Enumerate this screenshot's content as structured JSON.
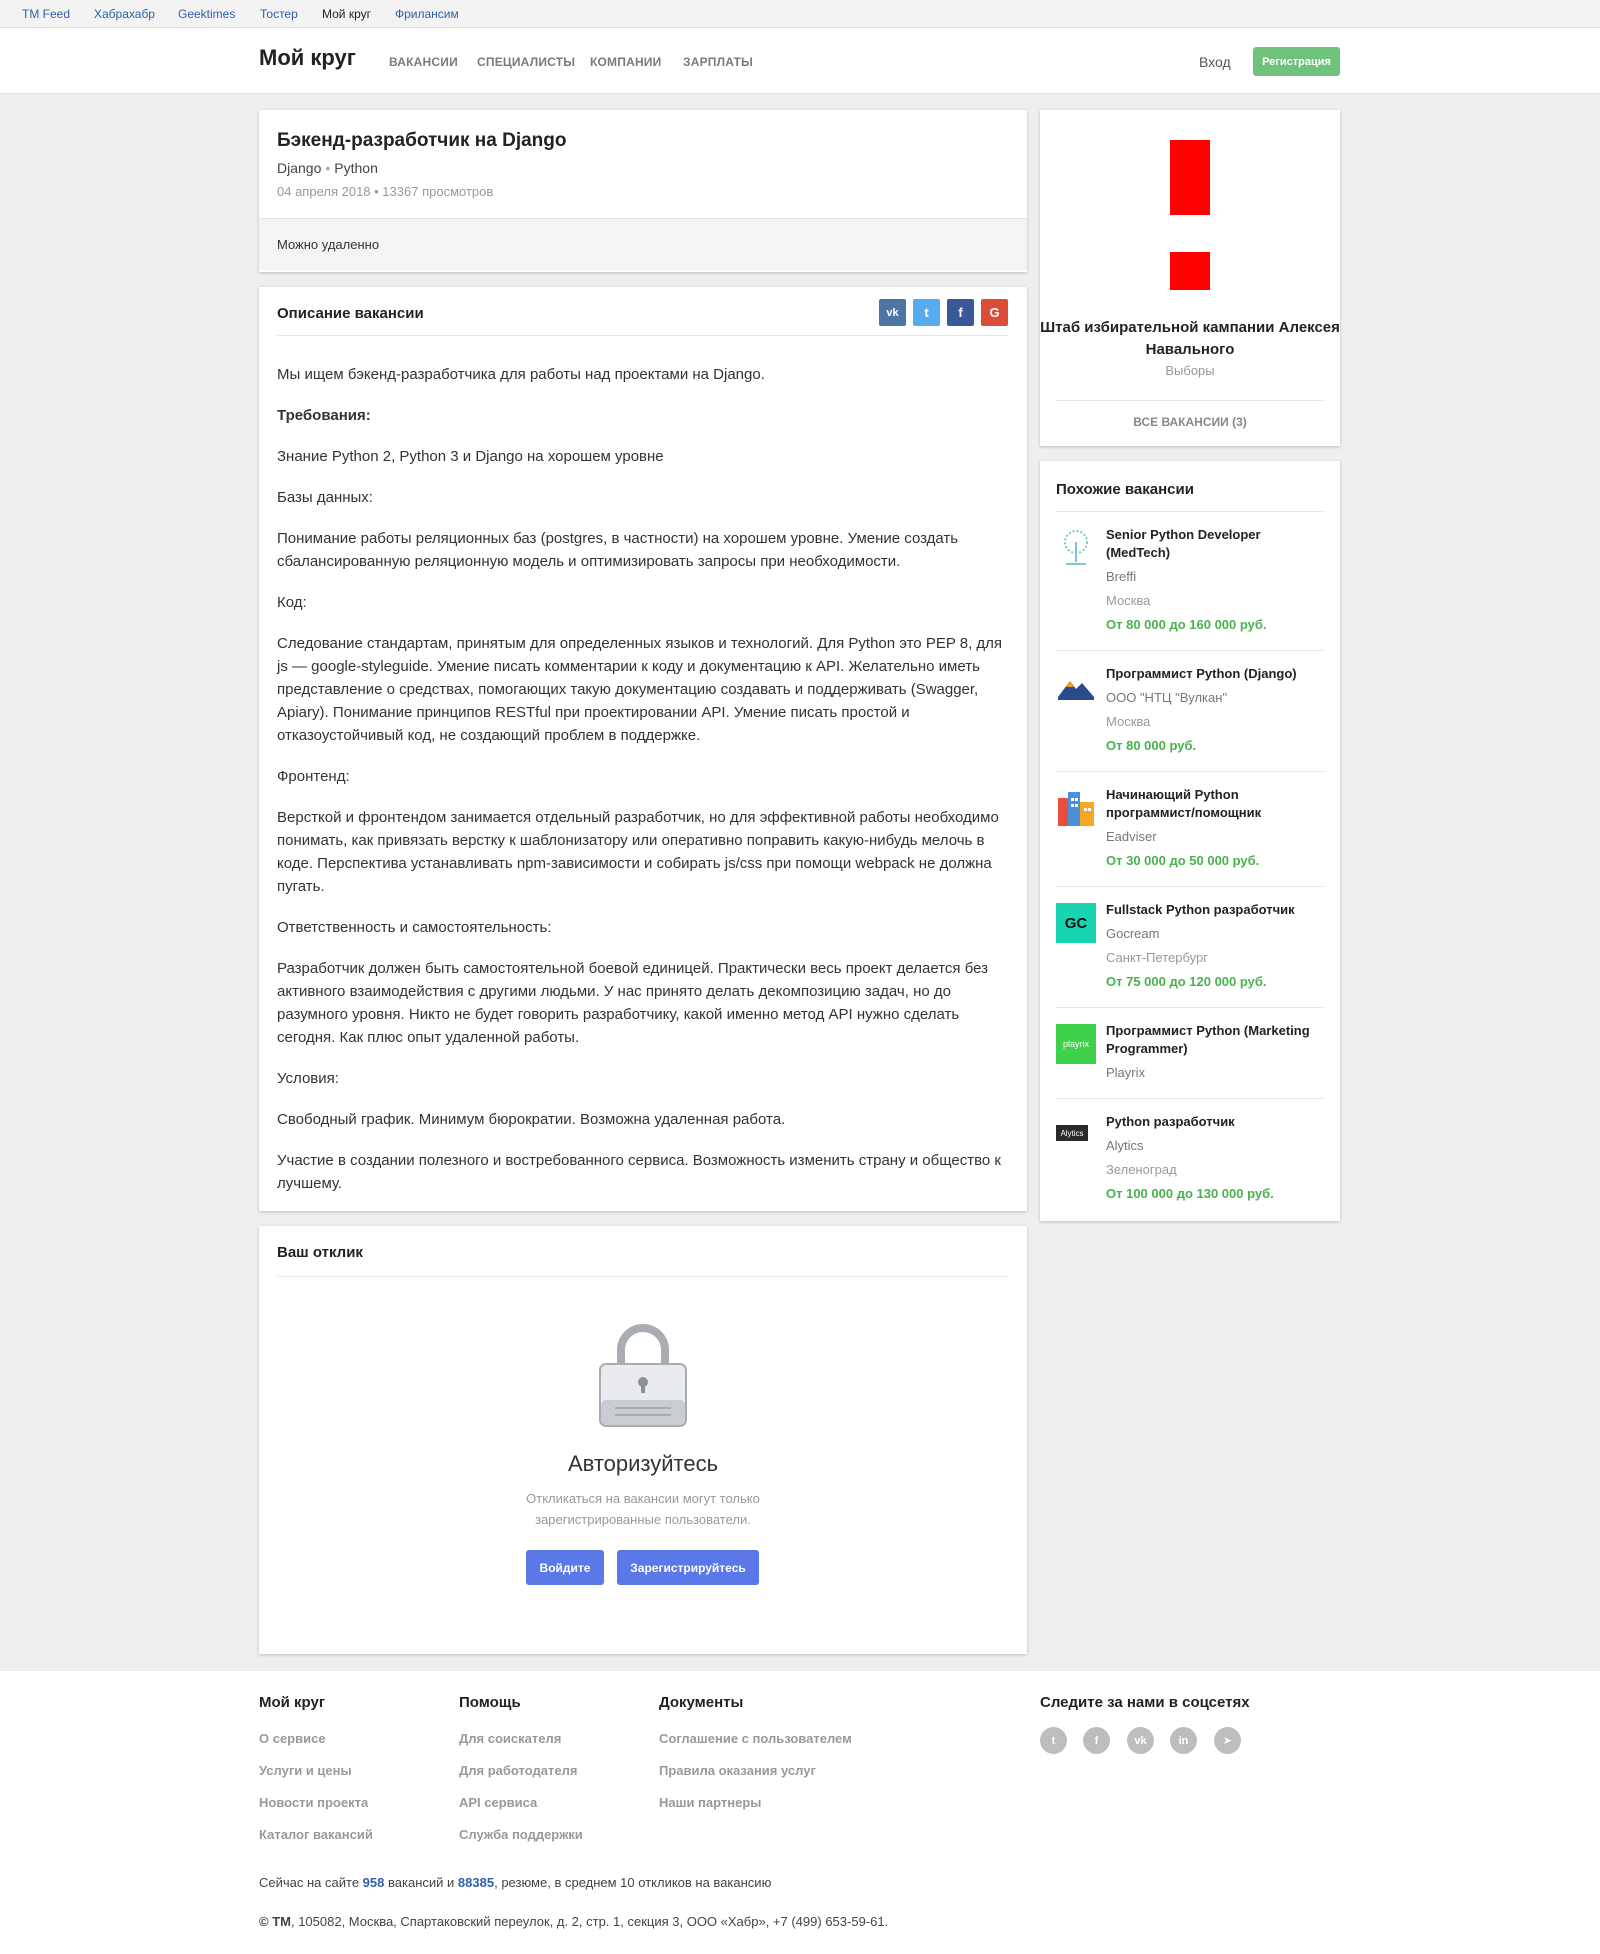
{
  "tm_bar": {
    "items": [
      "TM Feed",
      "Хабрахабр",
      "Geektimes",
      "Тостер",
      "Мой круг",
      "Фрилансим"
    ],
    "active": "Мой круг"
  },
  "header": {
    "logo": "Мой круг",
    "nav": [
      "ВАКАНСИИ",
      "СПЕЦИАЛИСТЫ",
      "КОМПАНИИ",
      "ЗАРПЛАТЫ"
    ],
    "login": "Вход",
    "register": "Регистрация"
  },
  "vacancy": {
    "title": "Бэкенд-разработчик на Django",
    "skills": [
      "Django",
      "Python"
    ],
    "skill_sep": "•",
    "meta": "04 апреля 2018 • 13367 просмотров",
    "remote": "Можно удаленно"
  },
  "description": {
    "title": "Описание вакансии",
    "share": [
      {
        "name": "vk",
        "label": "vk",
        "color": "#4c75a3"
      },
      {
        "name": "twitter",
        "label": "t",
        "color": "#55acee"
      },
      {
        "name": "facebook",
        "label": "f",
        "color": "#3b5998"
      },
      {
        "name": "google",
        "label": "G",
        "color": "#dd4b39"
      }
    ],
    "paragraphs": [
      "Мы ищем бэкенд-разработчика для работы над проектами на Django.",
      "Требования:",
      "Знание Python 2, Python 3 и Django на хорошем уровне",
      "Базы данных:",
      "Понимание работы реляционных баз (postgres, в частности) на хорошем уровне. Умение создать сбалансированную реляционную модель и оптимизировать запросы при необходимости.",
      "Код:",
      "Следование стандартам, принятым для определенных языков и технологий. Для Python это PEP 8, для js — google-styleguide. Умение писать комментарии к коду и документацию к API. Желательно иметь представление о средствах, помогающих такую документацию создавать и поддерживать (Swagger, Apiary). Понимание принципов RESTful при проектировании API. Умение писать простой и отказоустойчивый код, не создающий проблем в поддержке.",
      "Фронтенд:",
      "Версткой и фронтендом занимается отдельный разработчик, но для эффективной работы необходимо понимать, как привязать верстку к шаблонизатору или оперативно поправить какую-нибудь мелочь в коде. Перспектива устанавливать npm-зависимости и собирать js/css при помощи webpack не должна пугать.",
      "Ответственность и самостоятельность:",
      "Разработчик должен быть самостоятельной боевой единицей. Практически весь проект делается без активного взаимодействия с другими людьми. У нас принято делать декомпозицию задач, но до разумного уровня. Никто не будет говорить разработчику, какой именно метод API нужно сделать сегодня. Как плюс опыт удаленной работы.",
      "Условия:",
      "Свободный график. Минимум бюрократии. Возможна удаленная работа.",
      "Участие в создании полезного и востребованного сервиса. Возможность изменить страну и общество к лучшему."
    ]
  },
  "response": {
    "title": "Ваш отклик",
    "auth_title": "Авторизуйтесь",
    "auth_text": "Откликаться на вакансии могут только зарегистрированные пользователи.",
    "login_btn": "Войдите",
    "register_btn": "Зарегистрируйтесь"
  },
  "company": {
    "name": "Штаб избирательной кампании Алексея Навального",
    "category": "Выборы",
    "all_vacancies": "ВСЕ ВАКАНСИИ (3)",
    "logo_color": "#ff0000"
  },
  "similar": {
    "title": "Похожие вакансии",
    "items": [
      {
        "title": "Senior Python Developer (MedTech)",
        "company": "Breffi",
        "city": "Москва",
        "salary": "От 80 000 до 160 000 руб."
      },
      {
        "title": "Программист Python (Django)",
        "company": "ООО \"НТЦ \"Вулкан\"",
        "city": "Москва",
        "salary": "От 80 000 руб."
      },
      {
        "title": "Начинающий Python программист/помощник",
        "company": "Eadviser",
        "city": "",
        "salary": "От 30 000 до 50 000 руб."
      },
      {
        "title": "Fullstack Python разработчик",
        "company": "Gocream",
        "city": "Санкт-Петербург",
        "salary": "От 75 000 до 120 000 руб."
      },
      {
        "title": "Программист Python (Marketing Programmer)",
        "company": "Playrix",
        "city": "",
        "salary": ""
      },
      {
        "title": "Python разработчик",
        "company": "Alytics",
        "city": "Зеленоград",
        "salary": "От 100 000 до 130 000 руб."
      }
    ],
    "logo_texts": {
      "gocream": "GC",
      "playrix": "playrix",
      "alytics": "Alytics"
    }
  },
  "footer": {
    "col1": {
      "title": "Мой круг",
      "links": [
        "О сервисе",
        "Услуги и цены",
        "Новости проекта",
        "Каталог вакансий"
      ]
    },
    "col2": {
      "title": "Помощь",
      "links": [
        "Для соискателя",
        "Для работодателя",
        "API сервиса",
        "Служба поддержки"
      ]
    },
    "col3": {
      "title": "Документы",
      "links": [
        "Соглашение с пользователем",
        "Правила оказания услуг",
        "Наши партнеры"
      ]
    },
    "social_title": "Следите за нами в соцсетях",
    "social": [
      {
        "name": "twitter",
        "glyph": "t"
      },
      {
        "name": "facebook",
        "glyph": "f"
      },
      {
        "name": "vk",
        "glyph": "vk"
      },
      {
        "name": "linkedin",
        "glyph": "in"
      },
      {
        "name": "telegram",
        "glyph": "➤"
      }
    ],
    "stats_prefix": "Сейчас на сайте",
    "stats_vacancies": "958",
    "stats_mid": "вакансий и",
    "stats_resumes": "88385",
    "stats_suffix": "резюме, в среднем 10 откликов на вакансию",
    "copyright_prefix": "© TM",
    "copyright": ", 105082, Москва, Спартаковский переулок, д. 2, стр. 1, секция 3, ООО «Хабр», +7 (499) 653-59-61."
  }
}
